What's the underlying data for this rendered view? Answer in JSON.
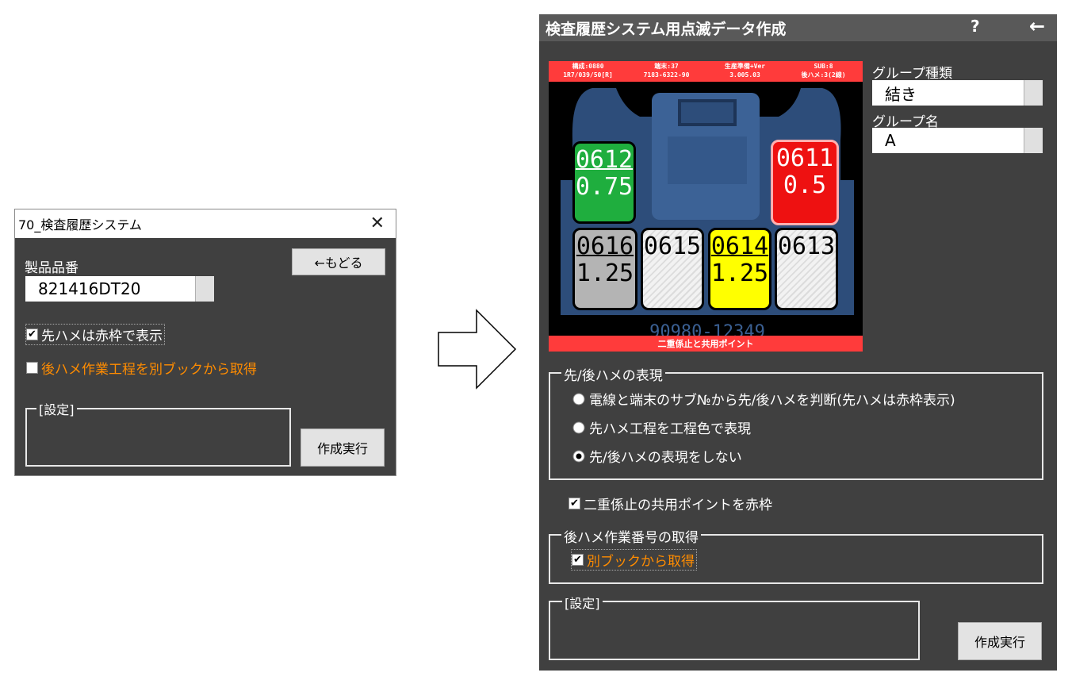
{
  "small_dialog": {
    "title": "70_検査履歴システム",
    "product_label": "製品品番",
    "product_value": "821416DT20",
    "back_button": "←もどる",
    "check1_label": "先ハメは赤枠で表示",
    "check1_checked": true,
    "check2_label": "後ハメ作業工程を別ブックから取得",
    "check2_checked": false,
    "settings_title": "[設定]",
    "run_button": "作成実行"
  },
  "large_dialog": {
    "title": "検査履歴システム用点滅データ作成",
    "help": "?",
    "back": "←",
    "connector": {
      "header": [
        {
          "line1": "構成:0880",
          "line2": "1R7/039/50[R]"
        },
        {
          "line1": "端末:37",
          "line2": "7183-6322-90"
        },
        {
          "line1": "生産準備+Ver",
          "line2": "3.005.03"
        },
        {
          "line1": "SUB:8",
          "line2": "後ハメ:3(2線)"
        }
      ],
      "footer": "二重係止と共用ポイント",
      "cavities": [
        {
          "num": "0612",
          "size": "0.75",
          "color": "#1fae3e"
        },
        {
          "num": "0611",
          "size": "0.5",
          "color": "#ee1111"
        },
        {
          "num": "0616",
          "size": "1.25",
          "color": "#b4b4b4"
        },
        {
          "num": "0615",
          "size": "",
          "color": "hatch"
        },
        {
          "num": "0614",
          "size": "1.25",
          "color": "#ffff00"
        },
        {
          "num": "0613",
          "size": "",
          "color": "hatch"
        }
      ]
    },
    "group_type_label": "グループ種類",
    "group_type_value": "結き",
    "group_name_label": "グループ名",
    "group_name_value": "A",
    "expr_title": "先/後ハメの表現",
    "radio1": "電線と端末のサブ№から先/後ハメを判断(先ハメは赤枠表示)",
    "radio2": "先ハメ工程を工程色で表現",
    "radio3": "先/後ハメの表現をしない",
    "radio_selected": 3,
    "double_lock_label": "二重係止の共用ポイントを赤枠",
    "double_lock_checked": true,
    "after_title": "後ハメ作業番号の取得",
    "other_book_label": "別ブックから取得",
    "other_book_checked": true,
    "settings_title": "[設定]",
    "run_button": "作成実行"
  },
  "colors": {
    "dialog_bg": "#404040",
    "orange_text": "#ff8c00",
    "title_bar": "#595959"
  }
}
